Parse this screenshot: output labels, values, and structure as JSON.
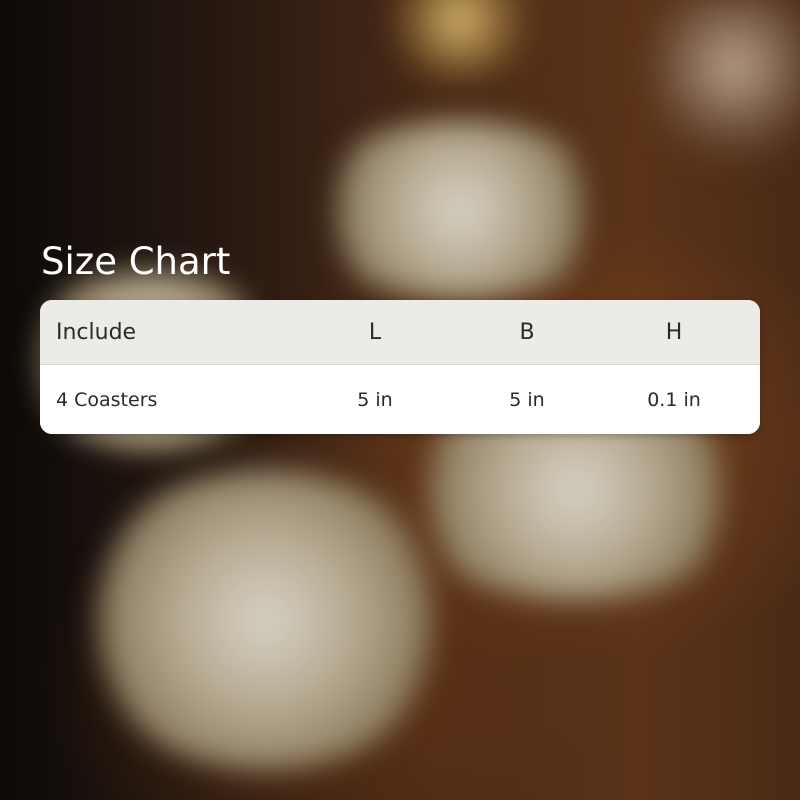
{
  "title": "Size Chart",
  "table": {
    "headers": [
      "Include",
      "L",
      "B",
      "H"
    ],
    "rows": [
      [
        "4 Coasters",
        "5 in",
        "5 in",
        "0.1 in"
      ]
    ]
  }
}
